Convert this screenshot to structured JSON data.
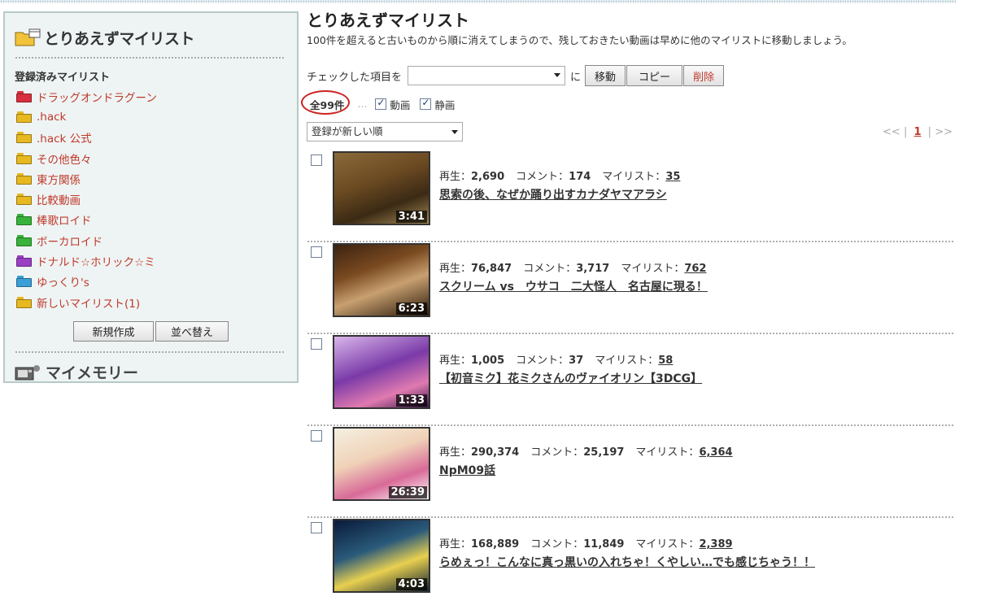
{
  "sidebar": {
    "title": "とりあえずマイリスト",
    "registered_label": "登録済みマイリスト",
    "folders": [
      {
        "label": "ドラッグオンドラグーン",
        "color": "#d9303e"
      },
      {
        "label": ".hack",
        "color": "#e8b820"
      },
      {
        "label": ".hack 公式",
        "color": "#e8b820"
      },
      {
        "label": "その他色々",
        "color": "#e8b820"
      },
      {
        "label": "東方関係",
        "color": "#e8b820"
      },
      {
        "label": "比較動画",
        "color": "#e8b820"
      },
      {
        "label": "棒歌ロイド",
        "color": "#38b23a"
      },
      {
        "label": "ボーカロイド",
        "color": "#38b23a"
      },
      {
        "label": "ドナルド☆ホリック☆ミ",
        "color": "#9b3fc4"
      },
      {
        "label": "ゆっくり's",
        "color": "#3a9fd6"
      },
      {
        "label": "新しいマイリスト(1)",
        "color": "#e8b820"
      }
    ],
    "new_button": "新規作成",
    "sort_button": "並べ替え",
    "memory_title": "マイメモリー"
  },
  "main": {
    "title": "とりあえずマイリスト",
    "notice": "100件を超えると古いものから順に消えてしまうので、残しておきたい動画は早めに他のマイリストに移動しましょう。",
    "checked_label": "チェックした項目を",
    "to_label": "に",
    "move_button": "移動",
    "copy_button": "コピー",
    "delete_button": "削除",
    "total": "全99件",
    "ellipsis": "…",
    "filter_video": "動画",
    "filter_image": "静画",
    "sort_value": "登録が新しい順",
    "pager": {
      "prev": "<<",
      "sep1": "|",
      "current": "1",
      "sep2": "|",
      "next": ">>"
    }
  },
  "labels": {
    "play": "再生：",
    "comment": "コメント：",
    "mylist": "マイリスト："
  },
  "videos": [
    {
      "play": "2,690",
      "comment": "174",
      "mylist": "35",
      "title": "思索の後、なぜか踊り出すカナダヤマアラシ",
      "duration": "3:41"
    },
    {
      "play": "76,847",
      "comment": "3,717",
      "mylist": "762",
      "title": "スクリーム vs　ウサコ　二大怪人　名古屋に現る！",
      "duration": "6:23"
    },
    {
      "play": "1,005",
      "comment": "37",
      "mylist": "58",
      "title": "【初音ミク】花ミクさんのヴァイオリン【3DCG】",
      "duration": "1:33"
    },
    {
      "play": "290,374",
      "comment": "25,197",
      "mylist": "6,364",
      "title": "NpM09話",
      "duration": "26:39"
    },
    {
      "play": "168,889",
      "comment": "11,849",
      "mylist": "2,389",
      "title": "らめぇっ！こんなに真っ黒いの入れちゃ！くやしい…でも感じちゃう！！",
      "duration": "4:03"
    }
  ]
}
